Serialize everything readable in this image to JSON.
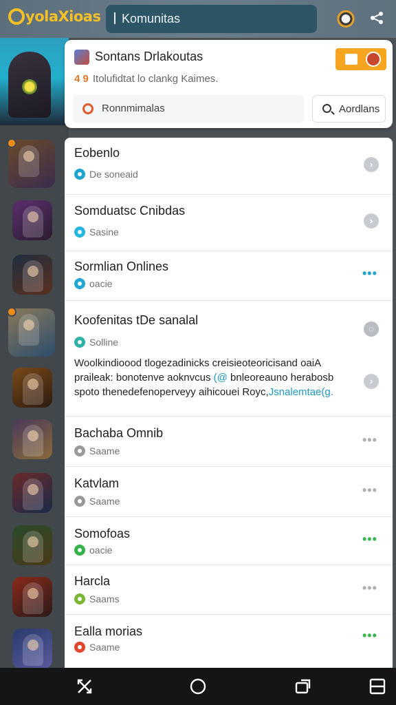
{
  "topbar": {
    "logo_text": "yolaXioas",
    "search_label": "Komunitas"
  },
  "icons": {
    "mascot": "mascot-avatar-icon",
    "share": "share-icon"
  },
  "header_card": {
    "title": "Sontans Drlakoutas",
    "subtitle_warn": "4 9",
    "subtitle": "Itolufidtat lo clankg Kaimes.",
    "filter_label": "Ronnmimalas",
    "search_button_label": "Aordlans"
  },
  "communities": [
    {
      "title": "Eobenlo",
      "status": "De soneaid",
      "status_color": "#1fa3cf",
      "action": "chevron"
    },
    {
      "title": "Somduatsc Cnibdas",
      "status": "Sasine",
      "status_color": "#25b6e0",
      "action": "chevron"
    },
    {
      "title": "Sormlian Onlines",
      "status": "oacie",
      "status_color": "#21a6d6",
      "action": "more",
      "action_color": "#27a2cc"
    },
    {
      "title": "Koofenitas tDe sanalal",
      "status": "Solline",
      "status_color": "#2fb3a6",
      "action": "loading",
      "description_1": "Woolkindioood tlogezadinicks creisieoteoricisand oaiA praileak: bonotenve aoknvcus ",
      "description_highlight_1": "(@",
      "description_2": " bnleoreauno herabosb spoto thenedefenoperveyy aihicouei Royc,",
      "description_highlight_2": "Jsnalemtae(g."
    },
    {
      "title": "Bachaba Omnib",
      "status": "Saame",
      "status_color": "#9a9a9a",
      "action": "more",
      "action_color": "#b0b0b0"
    },
    {
      "title": "Katvlam",
      "status": "Saame",
      "status_color": "#9a9a9a",
      "action": "more",
      "action_color": "#b0b0b0"
    },
    {
      "title": "Somofoas",
      "status": "oacie",
      "status_color": "#35b34a",
      "action": "more",
      "action_color": "#3db454"
    },
    {
      "title": "Harcla",
      "status": "Saams",
      "status_color": "#7ab534",
      "action": "more",
      "action_color": "#b0b0b0"
    },
    {
      "title": "Ealla morias",
      "status": "Saame",
      "status_color": "#e2452b",
      "action": "more",
      "action_color": "#3db454"
    }
  ],
  "games": [
    {
      "name": "game-thumb-1",
      "colors": [
        "#6a4a2a",
        "#3b2c4e"
      ]
    },
    {
      "name": "game-thumb-2",
      "colors": [
        "#5b2f6e",
        "#2a1d2f"
      ]
    },
    {
      "name": "game-thumb-3",
      "colors": [
        "#1f2e3f",
        "#5a3020"
      ]
    },
    {
      "name": "game-thumb-4",
      "colors": [
        "#8a7a5a",
        "#2c4c6c"
      ]
    },
    {
      "name": "game-thumb-5",
      "colors": [
        "#7a4a1a",
        "#2d1a10"
      ]
    },
    {
      "name": "game-thumb-6",
      "colors": [
        "#4a3a5a",
        "#8a6a3a"
      ]
    },
    {
      "name": "game-thumb-7",
      "colors": [
        "#6a2a2a",
        "#1a2a4a"
      ]
    },
    {
      "name": "game-thumb-8",
      "colors": [
        "#2a4a2a",
        "#4a3a1a"
      ]
    },
    {
      "name": "game-thumb-9",
      "colors": [
        "#8a2a1a",
        "#2a1a1a"
      ]
    },
    {
      "name": "game-thumb-10",
      "colors": [
        "#2a3a6a",
        "#5a5aa0"
      ]
    }
  ],
  "bottom_nav": {
    "items": [
      "recent-apps-icon",
      "home-icon",
      "back-icon",
      "menu-icon"
    ]
  }
}
